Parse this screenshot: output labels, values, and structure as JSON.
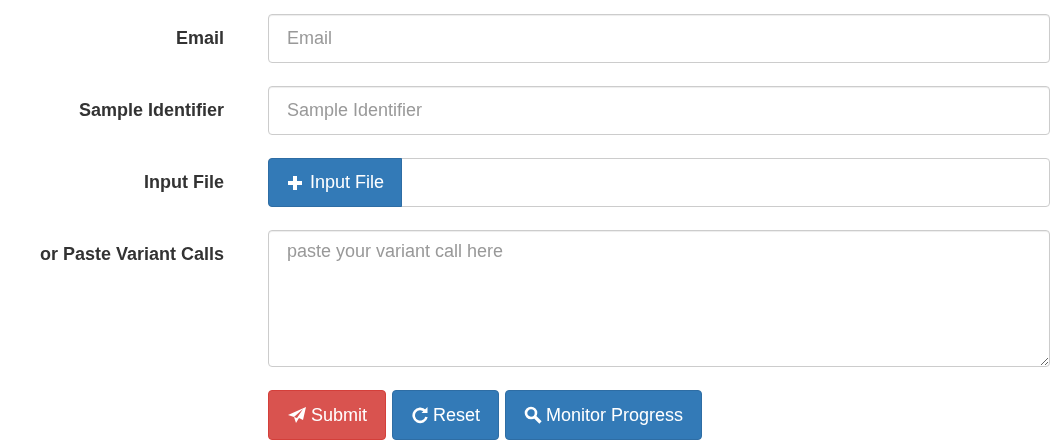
{
  "fields": [
    {
      "kind": "text",
      "label": "Email",
      "placeholder": "Email"
    },
    {
      "kind": "text",
      "label": "Sample Identifier",
      "placeholder": "Sample Identifier"
    },
    {
      "kind": "file",
      "label": "Input File",
      "button": "Input File"
    },
    {
      "kind": "textarea",
      "label": "or Paste Variant Calls",
      "placeholder": "paste your variant call here"
    }
  ],
  "buttons": [
    {
      "kind": "submit",
      "label": "Submit"
    },
    {
      "kind": "reset",
      "label": "Reset"
    },
    {
      "kind": "search",
      "label": "Monitor Progress"
    }
  ]
}
